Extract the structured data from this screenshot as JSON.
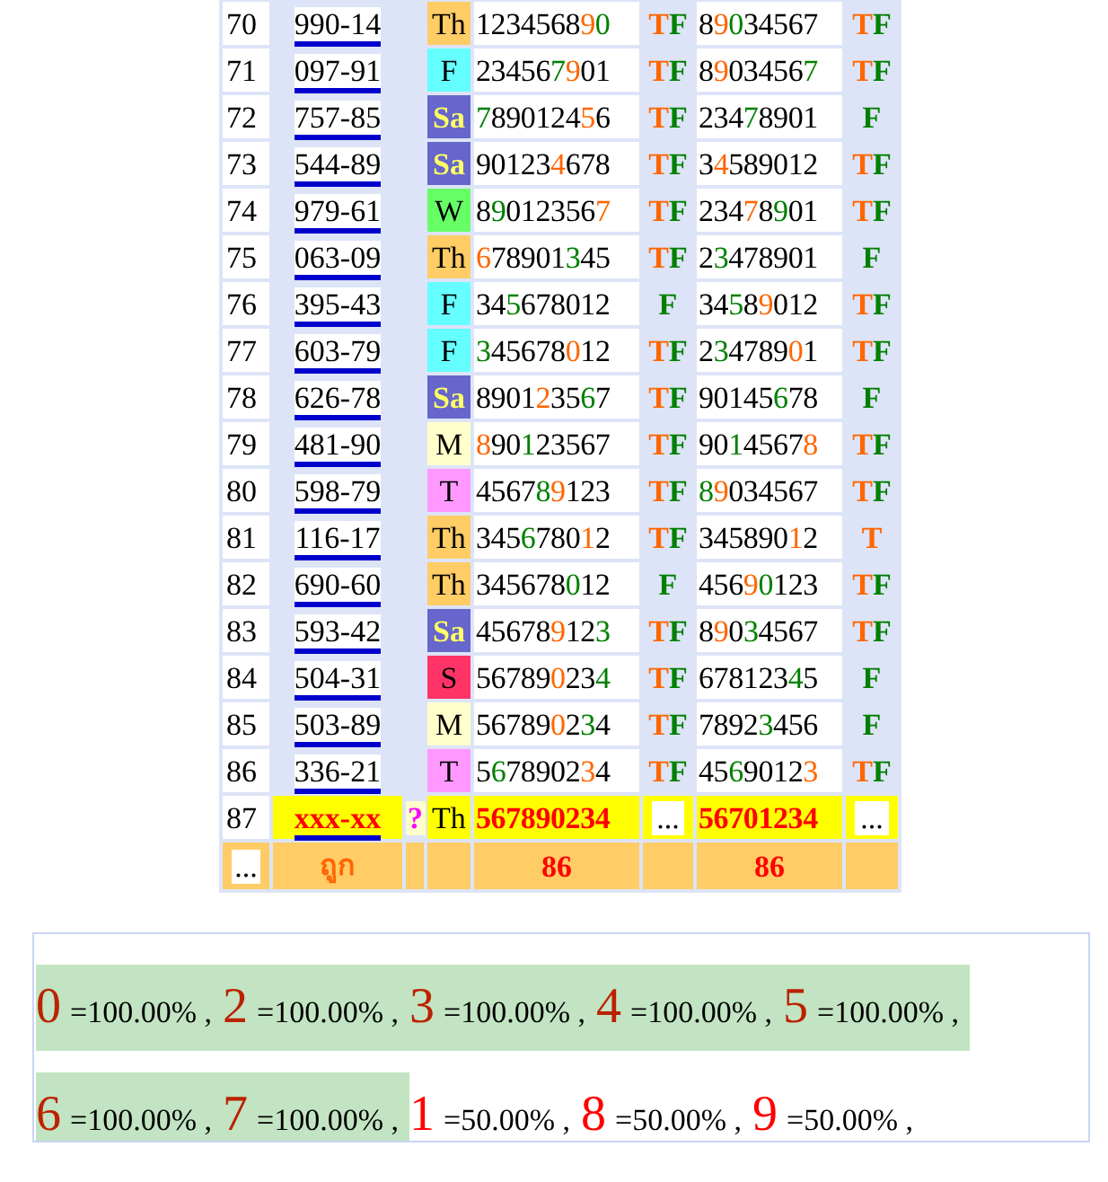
{
  "table": {
    "rows": [
      {
        "number": "70",
        "code": "990-14",
        "day": {
          "text": "Th",
          "color": "#ffcc66",
          "light_text": false
        },
        "highlighted": false,
        "first": [
          {
            "text": "1234568",
            "color": "#000000"
          },
          {
            "text": "9",
            "color": "#ff6600"
          },
          {
            "text": "0",
            "color": "#008000"
          }
        ],
        "first_result": [
          {
            "text": "T",
            "color": "#ff6600"
          },
          {
            "text": "F",
            "color": "#008000"
          }
        ],
        "second": [
          {
            "text": "8",
            "color": "#000000"
          },
          {
            "text": "9",
            "color": "#ff6600"
          },
          {
            "text": "0",
            "color": "#008000"
          },
          {
            "text": "34567",
            "color": "#000000"
          }
        ],
        "second_result": [
          {
            "text": "T",
            "color": "#ff6600"
          },
          {
            "text": "F",
            "color": "#008000"
          }
        ]
      },
      {
        "number": "71",
        "code": "097-91",
        "day": {
          "text": "F",
          "color": "#66ffff",
          "light_text": false
        },
        "highlighted": false,
        "first": [
          {
            "text": "23456",
            "color": "#000000"
          },
          {
            "text": "7",
            "color": "#008000"
          },
          {
            "text": "9",
            "color": "#ff6600"
          },
          {
            "text": "01",
            "color": "#000000"
          }
        ],
        "first_result": [
          {
            "text": "T",
            "color": "#ff6600"
          },
          {
            "text": "F",
            "color": "#008000"
          }
        ],
        "second": [
          {
            "text": "8",
            "color": "#000000"
          },
          {
            "text": "9",
            "color": "#ff6600"
          },
          {
            "text": "03456",
            "color": "#000000"
          },
          {
            "text": "7",
            "color": "#008000"
          }
        ],
        "second_result": [
          {
            "text": "T",
            "color": "#ff6600"
          },
          {
            "text": "F",
            "color": "#008000"
          }
        ]
      },
      {
        "number": "72",
        "code": "757-85",
        "day": {
          "text": "Sa",
          "color": "#6666cc",
          "light_text": true
        },
        "highlighted": false,
        "first": [
          {
            "text": "7",
            "color": "#008000"
          },
          {
            "text": "890124",
            "color": "#000000"
          },
          {
            "text": "5",
            "color": "#ff6600"
          },
          {
            "text": "6",
            "color": "#000000"
          }
        ],
        "first_result": [
          {
            "text": "T",
            "color": "#ff6600"
          },
          {
            "text": "F",
            "color": "#008000"
          }
        ],
        "second": [
          {
            "text": "234",
            "color": "#000000"
          },
          {
            "text": "7",
            "color": "#008000"
          },
          {
            "text": "8901",
            "color": "#000000"
          }
        ],
        "second_result": [
          {
            "text": "F",
            "color": "#008000"
          }
        ]
      },
      {
        "number": "73",
        "code": "544-89",
        "day": {
          "text": "Sa",
          "color": "#6666cc",
          "light_text": true
        },
        "highlighted": false,
        "first": [
          {
            "text": "90123",
            "color": "#000000"
          },
          {
            "text": "4",
            "color": "#ff6600"
          },
          {
            "text": "678",
            "color": "#000000"
          }
        ],
        "first_result": [
          {
            "text": "T",
            "color": "#ff6600"
          },
          {
            "text": "F",
            "color": "#008000"
          }
        ],
        "second": [
          {
            "text": "3",
            "color": "#000000"
          },
          {
            "text": "4",
            "color": "#ff6600"
          },
          {
            "text": "589012",
            "color": "#000000"
          }
        ],
        "second_result": [
          {
            "text": "T",
            "color": "#ff6600"
          },
          {
            "text": "F",
            "color": "#008000"
          }
        ]
      },
      {
        "number": "74",
        "code": "979-61",
        "day": {
          "text": "W",
          "color": "#66ff66",
          "light_text": false
        },
        "highlighted": false,
        "first": [
          {
            "text": "8",
            "color": "#000000"
          },
          {
            "text": "9",
            "color": "#008000"
          },
          {
            "text": "012356",
            "color": "#000000"
          },
          {
            "text": "7",
            "color": "#ff6600"
          }
        ],
        "first_result": [
          {
            "text": "T",
            "color": "#ff6600"
          },
          {
            "text": "F",
            "color": "#008000"
          }
        ],
        "second": [
          {
            "text": "234",
            "color": "#000000"
          },
          {
            "text": "7",
            "color": "#ff6600"
          },
          {
            "text": "8",
            "color": "#000000"
          },
          {
            "text": "9",
            "color": "#008000"
          },
          {
            "text": "01",
            "color": "#000000"
          }
        ],
        "second_result": [
          {
            "text": "T",
            "color": "#ff6600"
          },
          {
            "text": "F",
            "color": "#008000"
          }
        ]
      },
      {
        "number": "75",
        "code": "063-09",
        "day": {
          "text": "Th",
          "color": "#ffcc66",
          "light_text": false
        },
        "highlighted": false,
        "first": [
          {
            "text": "6",
            "color": "#ff6600"
          },
          {
            "text": "78901",
            "color": "#000000"
          },
          {
            "text": "3",
            "color": "#008000"
          },
          {
            "text": "45",
            "color": "#000000"
          }
        ],
        "first_result": [
          {
            "text": "T",
            "color": "#ff6600"
          },
          {
            "text": "F",
            "color": "#008000"
          }
        ],
        "second": [
          {
            "text": "2",
            "color": "#000000"
          },
          {
            "text": "3",
            "color": "#008000"
          },
          {
            "text": "478901",
            "color": "#000000"
          }
        ],
        "second_result": [
          {
            "text": "F",
            "color": "#008000"
          }
        ]
      },
      {
        "number": "76",
        "code": "395-43",
        "day": {
          "text": "F",
          "color": "#66ffff",
          "light_text": false
        },
        "highlighted": false,
        "first": [
          {
            "text": "34",
            "color": "#000000"
          },
          {
            "text": "5",
            "color": "#008000"
          },
          {
            "text": "678012",
            "color": "#000000"
          }
        ],
        "first_result": [
          {
            "text": "F",
            "color": "#008000"
          }
        ],
        "second": [
          {
            "text": "34",
            "color": "#000000"
          },
          {
            "text": "5",
            "color": "#008000"
          },
          {
            "text": "8",
            "color": "#000000"
          },
          {
            "text": "9",
            "color": "#ff6600"
          },
          {
            "text": "012",
            "color": "#000000"
          }
        ],
        "second_result": [
          {
            "text": "T",
            "color": "#ff6600"
          },
          {
            "text": "F",
            "color": "#008000"
          }
        ]
      },
      {
        "number": "77",
        "code": "603-79",
        "day": {
          "text": "F",
          "color": "#66ffff",
          "light_text": false
        },
        "highlighted": false,
        "first": [
          {
            "text": "3",
            "color": "#008000"
          },
          {
            "text": "45678",
            "color": "#000000"
          },
          {
            "text": "0",
            "color": "#ff6600"
          },
          {
            "text": "12",
            "color": "#000000"
          }
        ],
        "first_result": [
          {
            "text": "T",
            "color": "#ff6600"
          },
          {
            "text": "F",
            "color": "#008000"
          }
        ],
        "second": [
          {
            "text": "2",
            "color": "#000000"
          },
          {
            "text": "3",
            "color": "#008000"
          },
          {
            "text": "4789",
            "color": "#000000"
          },
          {
            "text": "0",
            "color": "#ff6600"
          },
          {
            "text": "1",
            "color": "#000000"
          }
        ],
        "second_result": [
          {
            "text": "T",
            "color": "#ff6600"
          },
          {
            "text": "F",
            "color": "#008000"
          }
        ]
      },
      {
        "number": "78",
        "code": "626-78",
        "day": {
          "text": "Sa",
          "color": "#6666cc",
          "light_text": true
        },
        "highlighted": false,
        "first": [
          {
            "text": "8901",
            "color": "#000000"
          },
          {
            "text": "2",
            "color": "#ff6600"
          },
          {
            "text": "35",
            "color": "#000000"
          },
          {
            "text": "6",
            "color": "#008000"
          },
          {
            "text": "7",
            "color": "#000000"
          }
        ],
        "first_result": [
          {
            "text": "T",
            "color": "#ff6600"
          },
          {
            "text": "F",
            "color": "#008000"
          }
        ],
        "second": [
          {
            "text": "90145",
            "color": "#000000"
          },
          {
            "text": "6",
            "color": "#008000"
          },
          {
            "text": "78",
            "color": "#000000"
          }
        ],
        "second_result": [
          {
            "text": "F",
            "color": "#008000"
          }
        ]
      },
      {
        "number": "79",
        "code": "481-90",
        "day": {
          "text": "M",
          "color": "#ffffcc",
          "light_text": false
        },
        "highlighted": false,
        "first": [
          {
            "text": "8",
            "color": "#ff6600"
          },
          {
            "text": "90",
            "color": "#000000"
          },
          {
            "text": "1",
            "color": "#008000"
          },
          {
            "text": "23567",
            "color": "#000000"
          }
        ],
        "first_result": [
          {
            "text": "T",
            "color": "#ff6600"
          },
          {
            "text": "F",
            "color": "#008000"
          }
        ],
        "second": [
          {
            "text": "90",
            "color": "#000000"
          },
          {
            "text": "1",
            "color": "#008000"
          },
          {
            "text": "4567",
            "color": "#000000"
          },
          {
            "text": "8",
            "color": "#ff6600"
          }
        ],
        "second_result": [
          {
            "text": "T",
            "color": "#ff6600"
          },
          {
            "text": "F",
            "color": "#008000"
          }
        ]
      },
      {
        "number": "80",
        "code": "598-79",
        "day": {
          "text": "T",
          "color": "#ff99ff",
          "light_text": false
        },
        "highlighted": false,
        "first": [
          {
            "text": "4567",
            "color": "#000000"
          },
          {
            "text": "8",
            "color": "#008000"
          },
          {
            "text": "9",
            "color": "#ff6600"
          },
          {
            "text": "123",
            "color": "#000000"
          }
        ],
        "first_result": [
          {
            "text": "T",
            "color": "#ff6600"
          },
          {
            "text": "F",
            "color": "#008000"
          }
        ],
        "second": [
          {
            "text": "8",
            "color": "#008000"
          },
          {
            "text": "9",
            "color": "#ff6600"
          },
          {
            "text": "034567",
            "color": "#000000"
          }
        ],
        "second_result": [
          {
            "text": "T",
            "color": "#ff6600"
          },
          {
            "text": "F",
            "color": "#008000"
          }
        ]
      },
      {
        "number": "81",
        "code": "116-17",
        "day": {
          "text": "Th",
          "color": "#ffcc66",
          "light_text": false
        },
        "highlighted": false,
        "first": [
          {
            "text": "345",
            "color": "#000000"
          },
          {
            "text": "6",
            "color": "#008000"
          },
          {
            "text": "780",
            "color": "#000000"
          },
          {
            "text": "1",
            "color": "#ff6600"
          },
          {
            "text": "2",
            "color": "#000000"
          }
        ],
        "first_result": [
          {
            "text": "T",
            "color": "#ff6600"
          },
          {
            "text": "F",
            "color": "#008000"
          }
        ],
        "second": [
          {
            "text": "345890",
            "color": "#000000"
          },
          {
            "text": "1",
            "color": "#ff6600"
          },
          {
            "text": "2",
            "color": "#000000"
          }
        ],
        "second_result": [
          {
            "text": "T",
            "color": "#ff6600"
          }
        ]
      },
      {
        "number": "82",
        "code": "690-60",
        "day": {
          "text": "Th",
          "color": "#ffcc66",
          "light_text": false
        },
        "highlighted": false,
        "first": [
          {
            "text": "345678",
            "color": "#000000"
          },
          {
            "text": "0",
            "color": "#008000"
          },
          {
            "text": "12",
            "color": "#000000"
          }
        ],
        "first_result": [
          {
            "text": "F",
            "color": "#008000"
          }
        ],
        "second": [
          {
            "text": "456",
            "color": "#000000"
          },
          {
            "text": "9",
            "color": "#ff6600"
          },
          {
            "text": "0",
            "color": "#008000"
          },
          {
            "text": "123",
            "color": "#000000"
          }
        ],
        "second_result": [
          {
            "text": "T",
            "color": "#ff6600"
          },
          {
            "text": "F",
            "color": "#008000"
          }
        ]
      },
      {
        "number": "83",
        "code": "593-42",
        "day": {
          "text": "Sa",
          "color": "#6666cc",
          "light_text": true
        },
        "highlighted": false,
        "first": [
          {
            "text": "45678",
            "color": "#000000"
          },
          {
            "text": "9",
            "color": "#ff6600"
          },
          {
            "text": "12",
            "color": "#000000"
          },
          {
            "text": "3",
            "color": "#008000"
          }
        ],
        "first_result": [
          {
            "text": "T",
            "color": "#ff6600"
          },
          {
            "text": "F",
            "color": "#008000"
          }
        ],
        "second": [
          {
            "text": "8",
            "color": "#000000"
          },
          {
            "text": "9",
            "color": "#ff6600"
          },
          {
            "text": "0",
            "color": "#000000"
          },
          {
            "text": "3",
            "color": "#008000"
          },
          {
            "text": "4567",
            "color": "#000000"
          }
        ],
        "second_result": [
          {
            "text": "T",
            "color": "#ff6600"
          },
          {
            "text": "F",
            "color": "#008000"
          }
        ]
      },
      {
        "number": "84",
        "code": "504-31",
        "day": {
          "text": "S",
          "color": "#ff3366",
          "light_text": false
        },
        "highlighted": false,
        "first": [
          {
            "text": "56789",
            "color": "#000000"
          },
          {
            "text": "0",
            "color": "#ff6600"
          },
          {
            "text": "23",
            "color": "#000000"
          },
          {
            "text": "4",
            "color": "#008000"
          }
        ],
        "first_result": [
          {
            "text": "T",
            "color": "#ff6600"
          },
          {
            "text": "F",
            "color": "#008000"
          }
        ],
        "second": [
          {
            "text": "678123",
            "color": "#000000"
          },
          {
            "text": "4",
            "color": "#008000"
          },
          {
            "text": "5",
            "color": "#000000"
          }
        ],
        "second_result": [
          {
            "text": "F",
            "color": "#008000"
          }
        ]
      },
      {
        "number": "85",
        "code": "503-89",
        "day": {
          "text": "M",
          "color": "#ffffcc",
          "light_text": false
        },
        "highlighted": false,
        "first": [
          {
            "text": "56789",
            "color": "#000000"
          },
          {
            "text": "0",
            "color": "#ff6600"
          },
          {
            "text": "2",
            "color": "#000000"
          },
          {
            "text": "3",
            "color": "#008000"
          },
          {
            "text": "4",
            "color": "#000000"
          }
        ],
        "first_result": [
          {
            "text": "T",
            "color": "#ff6600"
          },
          {
            "text": "F",
            "color": "#008000"
          }
        ],
        "second": [
          {
            "text": "7892",
            "color": "#000000"
          },
          {
            "text": "3",
            "color": "#008000"
          },
          {
            "text": "456",
            "color": "#000000"
          }
        ],
        "second_result": [
          {
            "text": "F",
            "color": "#008000"
          }
        ]
      },
      {
        "number": "86",
        "code": "336-21",
        "day": {
          "text": "T",
          "color": "#ff99ff",
          "light_text": false
        },
        "highlighted": false,
        "first": [
          {
            "text": "5",
            "color": "#000000"
          },
          {
            "text": "6",
            "color": "#008000"
          },
          {
            "text": "78902",
            "color": "#000000"
          },
          {
            "text": "3",
            "color": "#ff6600"
          },
          {
            "text": "4",
            "color": "#000000"
          }
        ],
        "first_result": [
          {
            "text": "T",
            "color": "#ff6600"
          },
          {
            "text": "F",
            "color": "#008000"
          }
        ],
        "second": [
          {
            "text": "45",
            "color": "#000000"
          },
          {
            "text": "6",
            "color": "#008000"
          },
          {
            "text": "9012",
            "color": "#000000"
          },
          {
            "text": "3",
            "color": "#ff6600"
          }
        ],
        "second_result": [
          {
            "text": "T",
            "color": "#ff6600"
          },
          {
            "text": "F",
            "color": "#008000"
          }
        ]
      },
      {
        "number": "87",
        "code": "xxx-xx",
        "flag": "?",
        "day": {
          "text": "Th",
          "color": "#ffff00",
          "light_text": false
        },
        "highlighted": true,
        "first": [
          {
            "text": "567890234",
            "color": "#ff0000"
          }
        ],
        "first_result": [
          {
            "text": "...",
            "color": "#000000"
          }
        ],
        "second": [
          {
            "text": "56701234",
            "color": "#ff0000"
          }
        ],
        "second_result": [
          {
            "text": "...",
            "color": "#000000"
          }
        ]
      }
    ],
    "footer": {
      "column_1": "...",
      "label": "ถูก",
      "first_count": "86",
      "second_count": "86"
    }
  },
  "summary": [
    {
      "digit": "0",
      "percent": "=100.00% ,",
      "full": true
    },
    {
      "digit": "2",
      "percent": "=100.00% ,",
      "full": true
    },
    {
      "digit": "3",
      "percent": "=100.00% ,",
      "full": true
    },
    {
      "digit": "4",
      "percent": "=100.00% ,",
      "full": true
    },
    {
      "digit": "5",
      "percent": "=100.00% ,",
      "full": true
    },
    {
      "digit": "6",
      "percent": "=100.00% ,",
      "full": true
    },
    {
      "digit": "7",
      "percent": "=100.00% ,",
      "full": true
    },
    {
      "digit": "1",
      "percent": "=50.00% ,",
      "full": false
    },
    {
      "digit": "8",
      "percent": "=50.00% ,",
      "full": false
    },
    {
      "digit": "9",
      "percent": "=50.00% ,",
      "full": false
    }
  ]
}
